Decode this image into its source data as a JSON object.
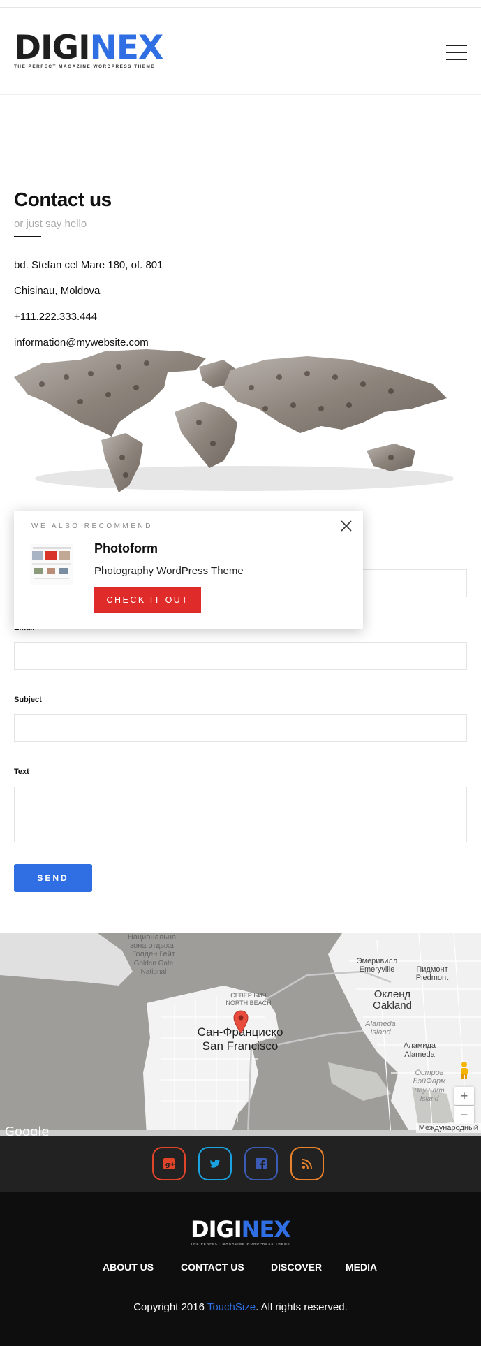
{
  "header": {
    "logo_part1": "DIGI",
    "logo_part2": "NEX",
    "tagline": "THE PERFECT MAGAZINE WORDPRESS THEME"
  },
  "contact": {
    "title": "Contact us",
    "subtitle": "or just say hello",
    "address": "bd. Stefan cel Mare 180, of. 801",
    "city": "Chisinau, Moldova",
    "phone": "+111.222.333.444",
    "email": "information@mywebsite.com"
  },
  "form": {
    "email_label": "Email",
    "subject_label": "Subject",
    "text_label": "Text",
    "send_label": "SEND"
  },
  "popup": {
    "kicker": "WE ALSO RECOMMEND",
    "title": "Photoform",
    "description": "Photography WordPress Theme",
    "button": "CHECK IT OUT"
  },
  "map": {
    "labels": {
      "park_ru": "Национальна зона отдыха",
      "golden_gate_ru": "Голден Гейт",
      "golden_gate_en": "Golden Gate National",
      "north_beach_ru": "СЕВЕР БИЧ",
      "north_beach_en": "NORTH BEACH",
      "emeryville_ru": "Эмеривилл",
      "emeryville_en": "Emeryville",
      "piedmont_ru": "Пидмонт",
      "piedmont_en": "Piedmont",
      "oakland_ru": "Окленд",
      "oakland_en": "Oakland",
      "sf_ru": "Сан-Франциско",
      "sf_en": "San Francisco",
      "alameda_island": "Alameda Island",
      "alameda_ru": "Аламида",
      "alameda_en": "Alameda",
      "bayfarm_ru": "Остров БэйФарм",
      "bayfarm_en": "Bay Farm Island"
    },
    "google": "Google",
    "attribution": "Международный",
    "zoom_in": "+",
    "zoom_out": "−"
  },
  "social": [
    {
      "name": "google-plus",
      "color": "#e0452a"
    },
    {
      "name": "twitter",
      "color": "#1aa3e0"
    },
    {
      "name": "facebook",
      "color": "#3b5bb5"
    },
    {
      "name": "rss",
      "color": "#e9822c"
    }
  ],
  "footer": {
    "logo_part1": "DIGI",
    "logo_part2": "NEX",
    "tagline": "THE PERFECT MAGAZINE WORDPRESS THEME",
    "nav": [
      "ABOUT US",
      "CONTACT US",
      "DISCOVER",
      "MEDIA"
    ],
    "copyright_pre": "Copyright 2016 ",
    "copyright_link": "TouchSize",
    "copyright_post": ". All rights reserved."
  },
  "colors": {
    "brand_blue": "#2f6fe3",
    "cta_red": "#e02b2b",
    "footer_bg": "#0e0e0e",
    "social_bg": "#222222"
  }
}
